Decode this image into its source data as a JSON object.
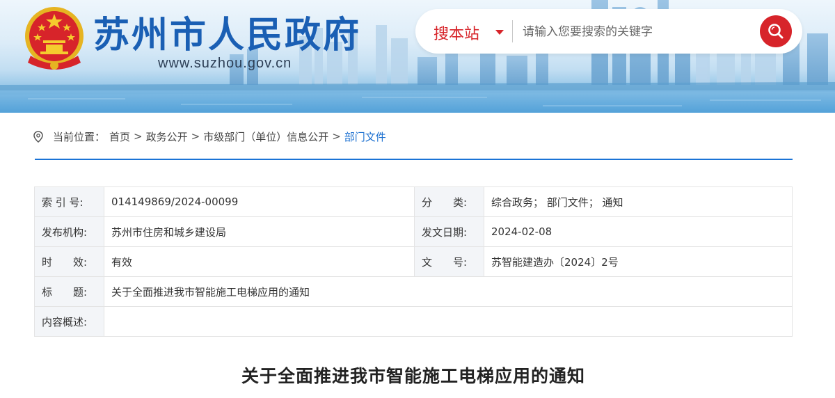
{
  "header": {
    "site_title": "苏州市人民政府",
    "site_url": "www.suzhou.gov.cn",
    "search": {
      "scope_label": "搜本站",
      "placeholder": "请输入您要搜索的关键字"
    }
  },
  "breadcrumb": {
    "label": "当前位置：",
    "items": [
      "首页",
      "政务公开",
      "市级部门（单位）信息公开",
      "部门文件"
    ],
    "separator": ">"
  },
  "info": {
    "index_no": {
      "label": "索 引 号:",
      "value": "014149869/2024-00099"
    },
    "category": {
      "label": "分　　类:",
      "value": "综合政务；  部门文件；  通知"
    },
    "publisher": {
      "label": "发布机构:",
      "value": "苏州市住房和城乡建设局"
    },
    "issue_date": {
      "label": "发文日期:",
      "value": "2024-02-08"
    },
    "validity": {
      "label": "时　　效:",
      "value": "有效"
    },
    "doc_no": {
      "label": "文　　号:",
      "value": "苏智能建造办〔2024〕2号"
    },
    "title": {
      "label": "标　　题:",
      "value": "关于全面推进我市智能施工电梯应用的通知"
    },
    "summary": {
      "label": "内容概述:",
      "value": ""
    }
  },
  "document": {
    "heading": "关于全面推进我市智能施工电梯应用的通知"
  },
  "colors": {
    "brand_blue": "#1a5fb4",
    "accent_red": "#d7242a",
    "link_blue": "#1a6fd0",
    "rule_blue": "#1a73d6"
  },
  "icons": [
    "national-emblem-icon",
    "search-icon",
    "location-pin-icon",
    "chevron-down-icon"
  ]
}
